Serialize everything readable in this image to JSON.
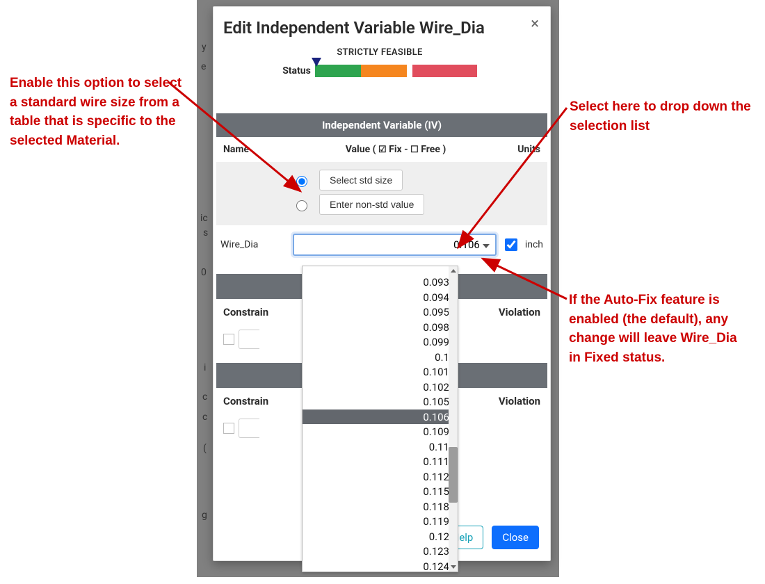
{
  "modal": {
    "title": "Edit Independent Variable Wire_Dia",
    "strictly_feasible": "STRICTLY FEASIBLE",
    "status_label": "Status",
    "iv_header": "Independent Variable (IV)",
    "columns": {
      "name": "Name",
      "value_prefix": "Value ( ",
      "fix_glyph": "☑",
      "fix_label": " Fix - ",
      "free_glyph": "☐",
      "free_label": " Free )",
      "units": "Units"
    },
    "radio": {
      "std_label": "Select std size",
      "non_std_label": "Enter non-std value",
      "selected": "std"
    },
    "variable": {
      "name": "Wire_Dia",
      "value": "0.106",
      "units": "inch",
      "auto_fix_checked": true
    },
    "dropdown_options": [
      "0.093",
      "0.094",
      "0.095",
      "0.098",
      "0.099",
      "0.1",
      "0.101",
      "0.102",
      "0.105",
      "0.106",
      "0.109",
      "0.11",
      "0.111",
      "0.112",
      "0.115",
      "0.118",
      "0.119",
      "0.12",
      "0.123",
      "0.124"
    ],
    "dropdown_selected": "0.106",
    "constrain_label": "Constrain",
    "violation_label": "Violation",
    "footer": {
      "help": "Help",
      "close": "Close"
    }
  },
  "status_colors": {
    "green": "#2ea44f",
    "orange": "#f5861f",
    "red": "#e14d5d",
    "indicator": "#1a237e"
  },
  "annotations": {
    "left": "Enable this option to select a standard wire size from a table that is specific to the selected Material.",
    "top_right": "Select here to drop down the selection list",
    "bottom_right": "If the Auto-Fix feature is enabled (the default), any change will leave Wire_Dia in Fixed status."
  },
  "background_fragments": {
    "frag1": "y",
    "frag2": "e",
    "frag3": "ic",
    "frag4": "s",
    "frag5": "0",
    "frag6": "i",
    "frag7": "c",
    "frag8": "c",
    "frag9": "(",
    "frag10": "g"
  }
}
